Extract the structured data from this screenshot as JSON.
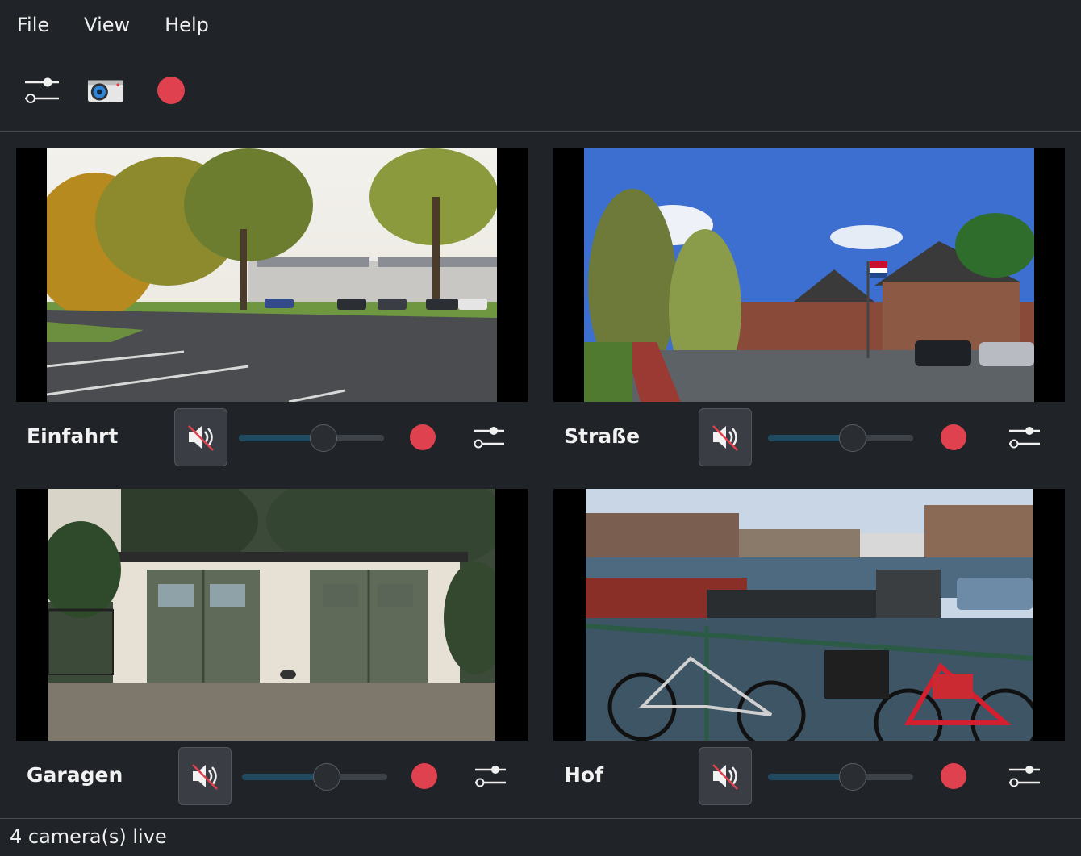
{
  "menu": [
    "File",
    "View",
    "Help"
  ],
  "toolbar": {
    "settings_icon": "sliders-icon",
    "camera_icon": "camera-icon",
    "record_icon": "record-icon",
    "record_color": "#e0414f"
  },
  "cameras": [
    {
      "name": "Einfahrt",
      "muted": true,
      "volume": 0.58
    },
    {
      "name": "Straße",
      "muted": true,
      "volume": 0.58
    },
    {
      "name": "Garagen",
      "muted": true,
      "volume": 0.58
    },
    {
      "name": "Hof",
      "muted": true,
      "volume": 0.58
    }
  ],
  "status": "4 camera(s) live",
  "colors": {
    "background": "#202327",
    "accent": "#1f4a60",
    "record": "#e0414f"
  }
}
